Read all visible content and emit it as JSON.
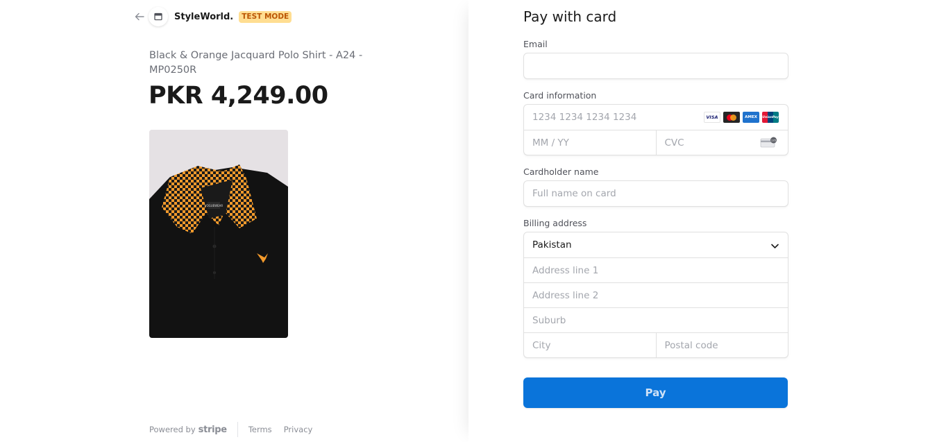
{
  "header": {
    "store_name": "StyleWorld.",
    "badge": "TEST MODE"
  },
  "product": {
    "name": "Black & Orange Jacquard Polo Shirt - A24 - MP0250R",
    "price": "PKR 4,249.00",
    "image_tag_text": "VOGUEWEAR"
  },
  "footer": {
    "powered_by": "Powered by",
    "stripe": "stripe",
    "terms": "Terms",
    "privacy": "Privacy"
  },
  "form": {
    "title": "Pay with card",
    "email_label": "Email",
    "email_value": "",
    "card_label": "Card information",
    "card_number_placeholder": "1234 1234 1234 1234",
    "expiry_placeholder": "MM / YY",
    "cvc_placeholder": "CVC",
    "cardholder_label": "Cardholder name",
    "cardholder_placeholder": "Full name on card",
    "billing_label": "Billing address",
    "country_value": "Pakistan",
    "address1_placeholder": "Address line 1",
    "address2_placeholder": "Address line 2",
    "suburb_placeholder": "Suburb",
    "city_placeholder": "City",
    "postal_placeholder": "Postal code",
    "pay_label": "Pay"
  },
  "card_brands": {
    "visa": "VISA",
    "amex": "AMEX",
    "unionpay": "UnionPay"
  },
  "colors": {
    "pay_button": "#0a74da",
    "badge_bg": "#ffde92",
    "badge_text": "#bb5504",
    "collar_orange": "#f39a2b"
  }
}
